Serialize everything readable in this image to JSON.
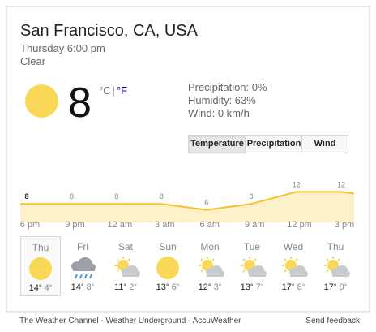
{
  "location": "San Francisco, CA, USA",
  "datetime": "Thursday 6:00 pm",
  "condition": "Clear",
  "current": {
    "temp": "8",
    "unit_c": "°C",
    "separator": "|",
    "unit_f": "°F",
    "icon": "sun-icon"
  },
  "details": {
    "precipitation": "Precipitation: 0%",
    "humidity": "Humidity: 63%",
    "wind": "Wind: 0 km/h"
  },
  "tabs": [
    "Temperature",
    "Precipitation",
    "Wind"
  ],
  "active_tab": "Temperature",
  "chart_data": {
    "type": "area",
    "labels": [
      "8",
      "8",
      "8",
      "8",
      "6",
      "8",
      "12",
      "12"
    ],
    "x_ticks": [
      "6 pm",
      "9 pm",
      "12 am",
      "3 am",
      "6 am",
      "9 am",
      "12 pm",
      "3 pm"
    ],
    "values": [
      8,
      8,
      8,
      8,
      6,
      8,
      12,
      12
    ],
    "colors": {
      "line": "#f7c02c",
      "fill": "#fdf1c9"
    }
  },
  "days": [
    {
      "name": "Thu",
      "hi": "14",
      "lo": "4",
      "icon": "sun-icon",
      "selected": true
    },
    {
      "name": "Fri",
      "hi": "14",
      "lo": "8",
      "icon": "rain-icon"
    },
    {
      "name": "Sat",
      "hi": "11",
      "lo": "2",
      "icon": "partly-cloudy-icon"
    },
    {
      "name": "Sun",
      "hi": "13",
      "lo": "6",
      "icon": "sun-icon"
    },
    {
      "name": "Mon",
      "hi": "12",
      "lo": "3",
      "icon": "partly-cloudy-icon"
    },
    {
      "name": "Tue",
      "hi": "13",
      "lo": "7",
      "icon": "partly-cloudy-icon"
    },
    {
      "name": "Wed",
      "hi": "17",
      "lo": "8",
      "icon": "partly-cloudy-icon"
    },
    {
      "name": "Thu",
      "hi": "17",
      "lo": "9",
      "icon": "partly-cloudy-icon"
    }
  ],
  "degree": "°",
  "footer": {
    "sources": "The Weather Channel - Weather Underground - AccuWeather",
    "feedback": "Send feedback"
  }
}
